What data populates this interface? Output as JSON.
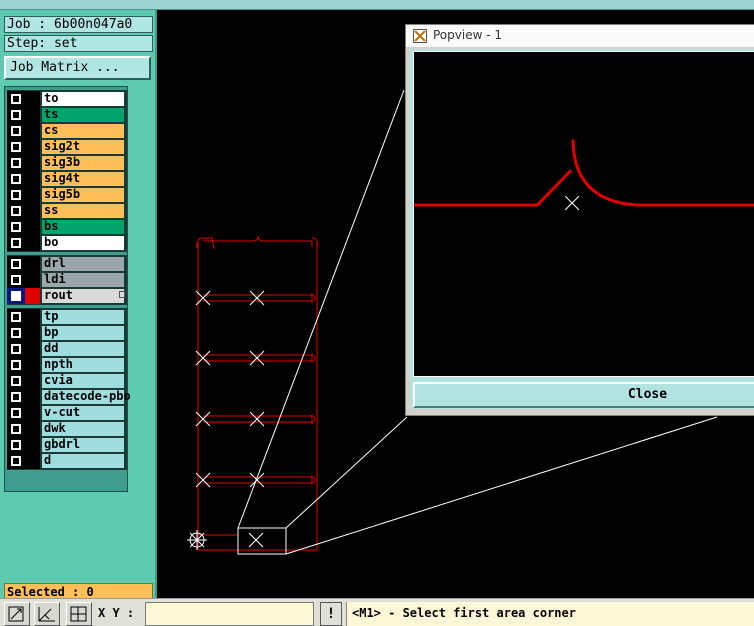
{
  "job_label": "Job : 6b00n047a0",
  "step_label": "Step: set",
  "job_matrix_button": "Job Matrix ...",
  "layer_groups": [
    [
      {
        "name": "to",
        "color": "white",
        "checked": false,
        "swatch": "black"
      },
      {
        "name": "ts",
        "color": "green",
        "checked": false,
        "swatch": "black"
      },
      {
        "name": "cs",
        "color": "orange",
        "checked": false,
        "swatch": "black"
      },
      {
        "name": "sig2t",
        "color": "orange",
        "checked": false,
        "swatch": "black"
      },
      {
        "name": "sig3b",
        "color": "orange",
        "checked": false,
        "swatch": "black"
      },
      {
        "name": "sig4t",
        "color": "orange",
        "checked": false,
        "swatch": "black"
      },
      {
        "name": "sig5b",
        "color": "orange",
        "checked": false,
        "swatch": "black"
      },
      {
        "name": "ss",
        "color": "orange",
        "checked": false,
        "swatch": "black"
      },
      {
        "name": "bs",
        "color": "green",
        "checked": false,
        "swatch": "black"
      },
      {
        "name": "bo",
        "color": "white",
        "checked": false,
        "swatch": "black"
      }
    ],
    [
      {
        "name": "drl",
        "color": "gray",
        "checked": false,
        "swatch": "black"
      },
      {
        "name": "ldi",
        "color": "gray",
        "checked": false,
        "swatch": "black"
      },
      {
        "name": "rout",
        "color": "lgray",
        "checked": true,
        "swatch": "red"
      }
    ],
    [
      {
        "name": "tp",
        "color": "cyan",
        "checked": false,
        "swatch": "black"
      },
      {
        "name": "bp",
        "color": "cyan",
        "checked": false,
        "swatch": "black"
      },
      {
        "name": "dd",
        "color": "cyan",
        "checked": false,
        "swatch": "black"
      },
      {
        "name": "npth",
        "color": "cyan",
        "checked": false,
        "swatch": "black"
      },
      {
        "name": "cvia",
        "color": "cyan",
        "checked": false,
        "swatch": "black"
      },
      {
        "name": "datecode-pbo",
        "color": "cyan",
        "checked": false,
        "swatch": "black"
      },
      {
        "name": "v-cut",
        "color": "cyan",
        "checked": false,
        "swatch": "black"
      },
      {
        "name": "dwk",
        "color": "cyan",
        "checked": false,
        "swatch": "black"
      },
      {
        "name": "gbdrl",
        "color": "cyan",
        "checked": false,
        "swatch": "black"
      },
      {
        "name": "d",
        "color": "cyan",
        "checked": false,
        "swatch": "black"
      }
    ]
  ],
  "selected_label": "Selected : 0",
  "toolbar": {
    "icons": [
      "zoom-fit-icon",
      "measure-icon",
      "snap-grid-icon"
    ],
    "xy_label": "X Y :",
    "xy_value": "",
    "exclaim_label": "!",
    "status": "<M1> - Select first area corner"
  },
  "popup": {
    "title": "Popview - 1",
    "close_label": "Close"
  },
  "colors": {
    "panel": "#5ecbb0",
    "route_line": "#e00000",
    "canvas": "#000000"
  }
}
